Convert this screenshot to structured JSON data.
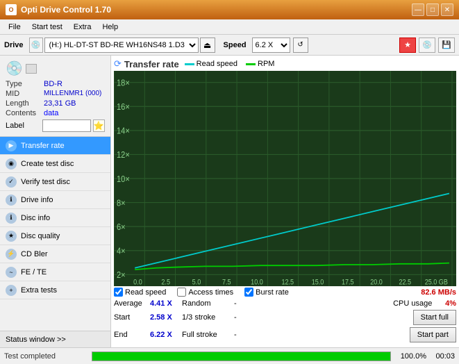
{
  "titlebar": {
    "title": "Opti Drive Control 1.70",
    "minimize": "—",
    "maximize": "□",
    "close": "✕"
  },
  "menubar": {
    "items": [
      "File",
      "Start test",
      "Extra",
      "Help"
    ]
  },
  "toolbar": {
    "drive_label": "Drive",
    "drive_value": "(H:)  HL-DT-ST BD-RE  WH16NS48 1.D3",
    "speed_label": "Speed",
    "speed_value": "6.2 X"
  },
  "sidebar": {
    "disc": {
      "type_label": "Type",
      "type_value": "BD-R",
      "mid_label": "MID",
      "mid_value": "MILLENMR1 (000)",
      "length_label": "Length",
      "length_value": "23,31 GB",
      "contents_label": "Contents",
      "contents_value": "data",
      "label_label": "Label",
      "label_value": ""
    },
    "nav": [
      {
        "id": "transfer-rate",
        "label": "Transfer rate",
        "active": true
      },
      {
        "id": "create-test-disc",
        "label": "Create test disc",
        "active": false
      },
      {
        "id": "verify-test-disc",
        "label": "Verify test disc",
        "active": false
      },
      {
        "id": "drive-info",
        "label": "Drive info",
        "active": false
      },
      {
        "id": "disc-info",
        "label": "Disc info",
        "active": false
      },
      {
        "id": "disc-quality",
        "label": "Disc quality",
        "active": false
      },
      {
        "id": "cd-bler",
        "label": "CD Bler",
        "active": false
      },
      {
        "id": "fe-te",
        "label": "FE / TE",
        "active": false
      },
      {
        "id": "extra-tests",
        "label": "Extra tests",
        "active": false
      }
    ],
    "status_window": "Status window >>"
  },
  "chart": {
    "title": "Transfer rate",
    "legend": [
      {
        "label": "Read speed",
        "color": "#00cccc"
      },
      {
        "label": "RPM",
        "color": "#00cc00"
      }
    ],
    "y_axis_labels": [
      "18×",
      "16×",
      "14×",
      "12×",
      "10×",
      "8×",
      "6×",
      "4×",
      "2×"
    ],
    "x_axis_labels": [
      "0.0",
      "2.5",
      "5.0",
      "7.5",
      "10.0",
      "12.5",
      "15.0",
      "17.5",
      "20.0",
      "22.5",
      "25.0 GB"
    ]
  },
  "footer": {
    "checkboxes": [
      {
        "label": "Read speed",
        "checked": true
      },
      {
        "label": "Access times",
        "checked": false
      },
      {
        "label": "Burst rate",
        "checked": true
      }
    ],
    "burst_rate_label": "Burst rate",
    "burst_rate_value": "82.6 MB/s",
    "stats": [
      {
        "label": "Average",
        "value": "4.41 X",
        "right_label": "Random",
        "right_value": "-",
        "btn": null
      },
      {
        "label": "Start",
        "value": "2.58 X",
        "right_label": "1/3 stroke",
        "right_value": "-",
        "btn": "Start full"
      },
      {
        "label": "End",
        "value": "6.22 X",
        "right_label": "Full stroke",
        "right_value": "-",
        "btn": "Start part"
      }
    ],
    "cpu_label": "CPU usage",
    "cpu_value": "4%"
  },
  "statusbar": {
    "text": "Test completed",
    "progress": 100,
    "progress_text": "100.0%",
    "time": "00:03"
  }
}
